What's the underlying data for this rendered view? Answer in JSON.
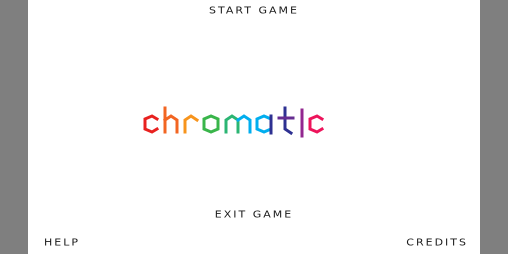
{
  "menu": {
    "start_label": "START GAME",
    "exit_label": "EXIT GAME",
    "help_label": "HELP",
    "credits_label": "CREDITS"
  },
  "logo": {
    "text": "chromatic",
    "letters": [
      {
        "char": "c",
        "color": "#e8211f"
      },
      {
        "char": "h",
        "color": "#f26522"
      },
      {
        "char": "r",
        "color": "#f7941d"
      },
      {
        "char": "o",
        "color": "#39b54a"
      },
      {
        "char": "m",
        "color": "#00aeef"
      },
      {
        "char": "a",
        "color": "#2e3192"
      },
      {
        "char": "t",
        "color": "#662d91"
      },
      {
        "char": "i",
        "color": "#92278f"
      },
      {
        "char": "c",
        "color": "#ed145b"
      }
    ]
  },
  "colors": {
    "frame": "#7f7f7f",
    "screen": "#ffffff",
    "menu_text": "#1a1a1a"
  }
}
